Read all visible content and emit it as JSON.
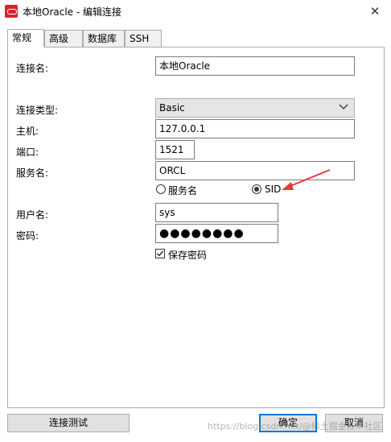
{
  "window": {
    "title": "本地Oracle - 编辑连接",
    "close_glyph": "✕"
  },
  "tabs": [
    {
      "label": "常规",
      "active": true
    },
    {
      "label": "高级"
    },
    {
      "label": "数据库"
    },
    {
      "label": "SSH"
    }
  ],
  "form": {
    "connection_name": {
      "label": "连接名:",
      "value": "本地Oracle"
    },
    "connection_type": {
      "label": "连接类型:",
      "value": "Basic"
    },
    "host": {
      "label": "主机:",
      "value": "127.0.0.1"
    },
    "port": {
      "label": "端口:",
      "value": "1521"
    },
    "service_name": {
      "label": "服务名:",
      "value": "ORCL"
    },
    "radio_service": {
      "label": "服务名",
      "checked": false
    },
    "radio_sid": {
      "label": "SID",
      "checked": true
    },
    "username": {
      "label": "用户名:",
      "value": "sys"
    },
    "password": {
      "label": "密码:",
      "value": "●●●●●●●●"
    },
    "save_password": {
      "label": "保存密码",
      "checked": true
    }
  },
  "buttons": {
    "test": "连接测试",
    "ok": "确定",
    "cancel": "取消"
  },
  "watermark": "https://blog.csdn.net/@稀土掘金技术社区",
  "colors": {
    "accent": "#0078d7",
    "annotation_arrow": "#e5393b",
    "brand_icon": "#d9232d"
  }
}
